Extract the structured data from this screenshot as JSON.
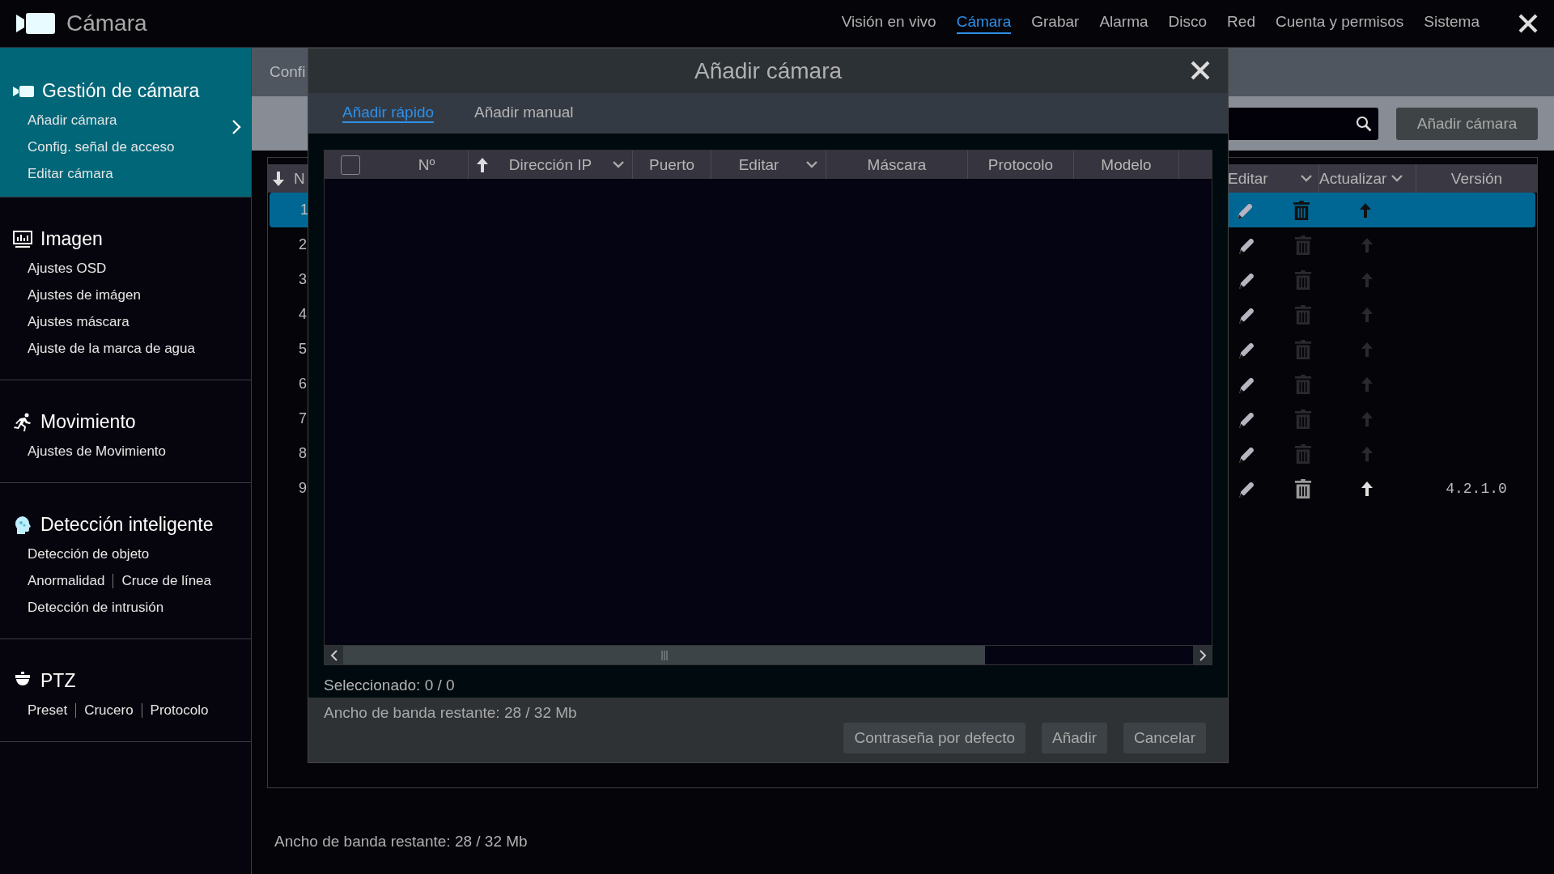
{
  "topbar": {
    "title": "Cámara",
    "nav": [
      {
        "label": "Visión en vivo",
        "selected": false
      },
      {
        "label": "Cámara",
        "selected": true
      },
      {
        "label": "Grabar",
        "selected": false
      },
      {
        "label": "Alarma",
        "selected": false
      },
      {
        "label": "Disco",
        "selected": false
      },
      {
        "label": "Red",
        "selected": false
      },
      {
        "label": "Cuenta y permisos",
        "selected": false
      },
      {
        "label": "Sistema",
        "selected": false
      }
    ]
  },
  "sidebar": {
    "sections": [
      {
        "kind": "camera",
        "title": "Gestión de cámara",
        "selected": true,
        "items": [
          [
            "Añadir cámara"
          ],
          [
            "Config. señal de acceso"
          ],
          [
            "Editar cámara"
          ]
        ]
      },
      {
        "kind": "image",
        "title": "Imagen",
        "selected": false,
        "items": [
          [
            "Ajustes OSD"
          ],
          [
            "Ajustes de imágen"
          ],
          [
            "Ajustes máscara"
          ],
          [
            "Ajuste de la marca de agua"
          ]
        ]
      },
      {
        "kind": "motion",
        "title": "Movimiento",
        "selected": false,
        "items": [
          [
            "Ajustes de Movimiento"
          ]
        ]
      },
      {
        "kind": "smart",
        "title": "Detección inteligente",
        "selected": false,
        "items": [
          [
            "Detección de objeto"
          ],
          [
            "Anormalidad",
            "Cruce de línea"
          ],
          [
            "Detección de intrusión"
          ]
        ]
      },
      {
        "kind": "ptz",
        "title": "PTZ",
        "selected": false,
        "items": [
          [
            "Preset",
            "Crucero",
            "Protocolo"
          ]
        ]
      }
    ]
  },
  "background": {
    "tab": "Confi",
    "add_button": "Añadir cámara",
    "table": {
      "left_columns": [
        {
          "label": "N",
          "sort_up": false,
          "sort_down": true,
          "menu": false
        }
      ],
      "right_columns": [
        {
          "label": "Editar",
          "sort_up": false,
          "sort_down": false,
          "menu": true
        },
        {
          "label": "Actualizar",
          "sort_up": false,
          "sort_down": false,
          "menu": true
        },
        {
          "label": "Versión",
          "sort_up": false,
          "sort_down": false,
          "menu": false
        }
      ],
      "rows": [
        {
          "number": "1",
          "selected": true,
          "enabled": false
        },
        {
          "number": "2",
          "selected": false,
          "enabled": false
        },
        {
          "number": "3",
          "selected": false,
          "enabled": false
        },
        {
          "number": "4",
          "selected": false,
          "enabled": false
        },
        {
          "number": "5",
          "selected": false,
          "enabled": false
        },
        {
          "number": "6",
          "selected": false,
          "enabled": false
        },
        {
          "number": "7",
          "selected": false,
          "enabled": false
        },
        {
          "number": "8",
          "selected": false,
          "enabled": false
        },
        {
          "number": "9",
          "selected": false,
          "enabled": true,
          "version": "4.2.1.0"
        }
      ]
    },
    "bandwidth": "Ancho de banda restante: 28 / 32 Mb"
  },
  "dialog": {
    "title": "Añadir cámara",
    "tabs": [
      {
        "label": "Añadir rápido",
        "selected": true
      },
      {
        "label": "Añadir manual",
        "selected": false
      }
    ],
    "table": {
      "select_all": {
        "checked": false
      },
      "columns": [
        {
          "label": "Nº",
          "sort_up": false,
          "sort_down": false,
          "menu": false
        },
        {
          "label": "Dirección IP",
          "sort_up": true,
          "sort_down": false,
          "menu": true
        },
        {
          "label": "Puerto",
          "sort_up": false,
          "sort_down": false,
          "menu": false
        },
        {
          "label": "Editar",
          "sort_up": false,
          "sort_down": false,
          "menu": true
        },
        {
          "label": "Máscara",
          "sort_up": false,
          "sort_down": false,
          "menu": false
        },
        {
          "label": "Protocolo",
          "sort_up": false,
          "sort_down": false,
          "menu": false
        },
        {
          "label": "Modelo",
          "sort_up": false,
          "sort_down": false,
          "menu": false
        }
      ]
    },
    "selected_count": "Seleccionado: 0 / 0",
    "bandwidth": "Ancho de banda restante: 28 / 32 Mb",
    "buttons": [
      "Contraseña por defecto",
      "Añadir",
      "Cancelar"
    ]
  }
}
